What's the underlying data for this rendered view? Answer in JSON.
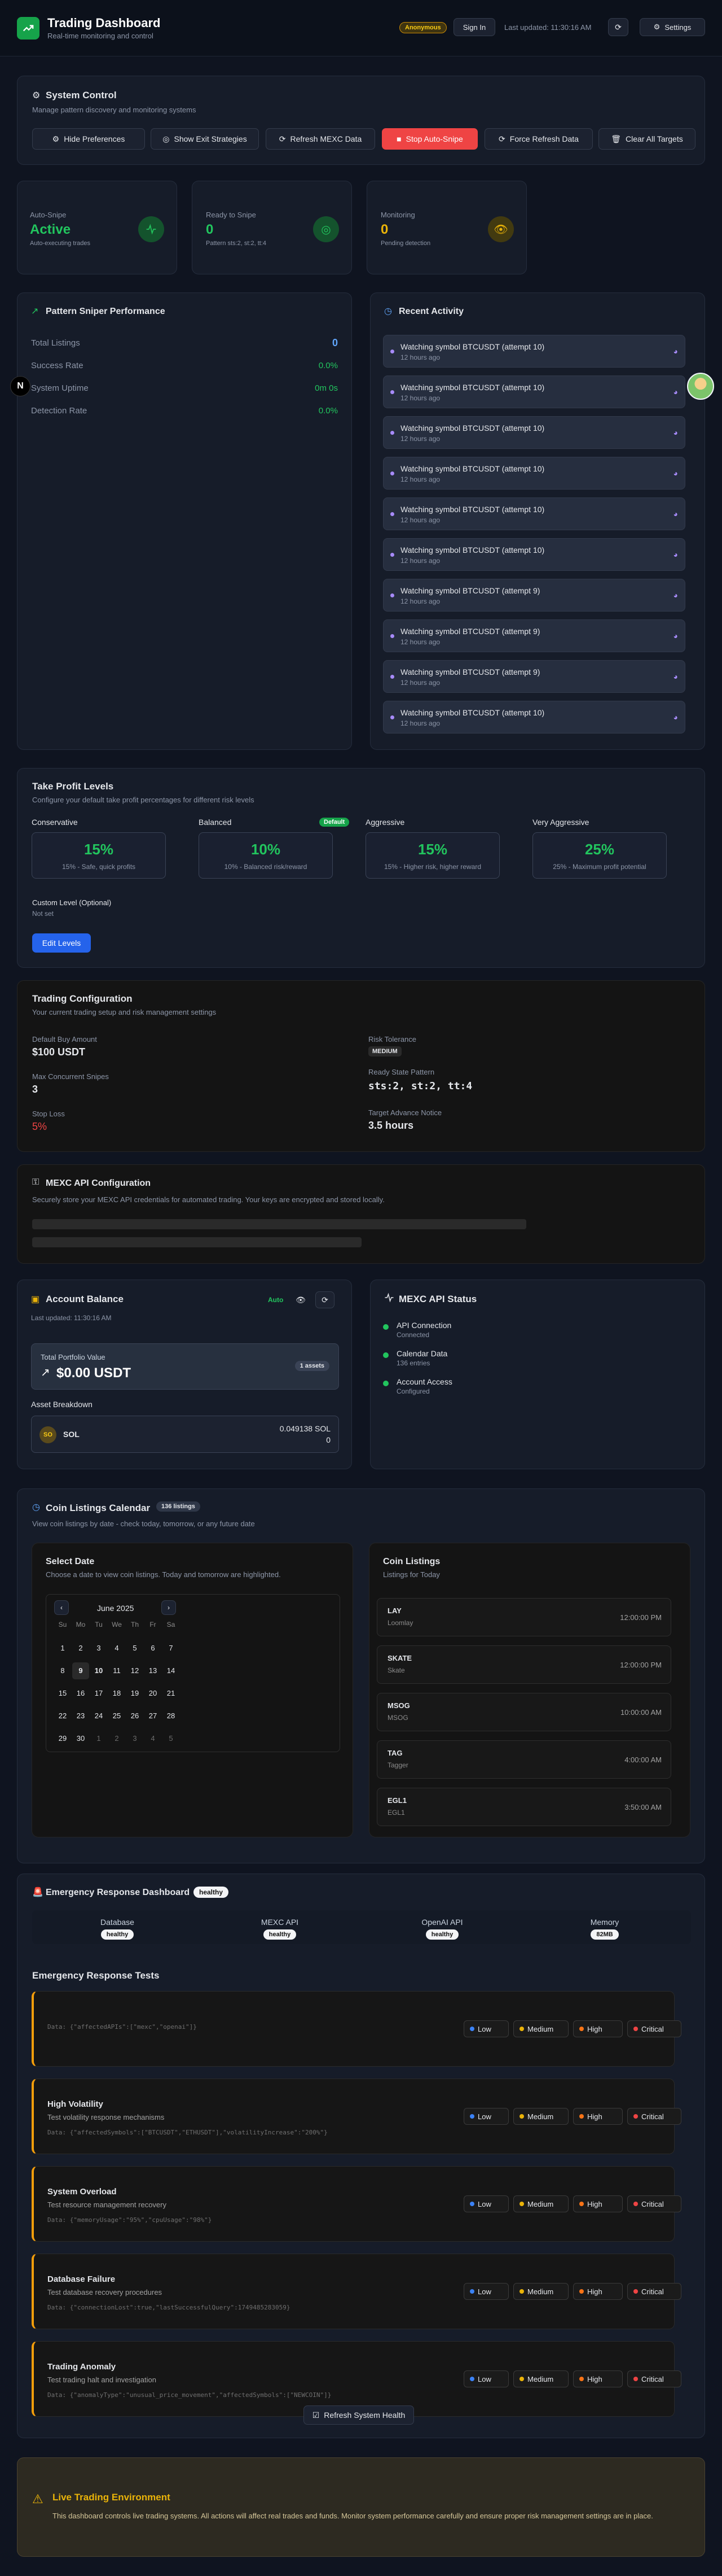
{
  "header": {
    "title": "Trading Dashboard",
    "subtitle": "Real-time monitoring and control",
    "user_badge": "Anonymous",
    "signin_label": "Sign In",
    "last_updated": "Last updated: 11:30:16 AM",
    "settings_label": "Settings"
  },
  "system_control": {
    "title": "System Control",
    "subtitle": "Manage pattern discovery and monitoring systems",
    "buttons": {
      "hide_prefs": "Hide Preferences",
      "show_exit": "Show Exit Strategies",
      "refresh_mexc": "Refresh MEXC Data",
      "stop_auto": "Stop Auto-Snipe",
      "force_refresh": "Force Refresh Data",
      "clear_targets": "Clear All Targets"
    }
  },
  "stats": {
    "auto_snipe": {
      "label": "Auto-Snipe",
      "value": "Active",
      "sub": "Auto-executing trades"
    },
    "ready": {
      "label": "Ready to Snipe",
      "value": "0",
      "sub": "Pattern sts:2, st:2, tt:4"
    },
    "monitoring": {
      "label": "Monitoring",
      "value": "0",
      "sub": "Pending detection"
    }
  },
  "performance": {
    "title": "Pattern Sniper Performance",
    "rows": [
      {
        "label": "Total Listings",
        "value": "0"
      },
      {
        "label": "Success Rate",
        "value": "0.0%"
      },
      {
        "label": "System Uptime",
        "value": "0m 0s"
      },
      {
        "label": "Detection Rate",
        "value": "0.0%"
      }
    ]
  },
  "activity": {
    "title": "Recent Activity",
    "items": [
      {
        "text": "Watching symbol BTCUSDT (attempt 10)",
        "time": "12 hours ago"
      },
      {
        "text": "Watching symbol BTCUSDT (attempt 10)",
        "time": "12 hours ago"
      },
      {
        "text": "Watching symbol BTCUSDT (attempt 10)",
        "time": "12 hours ago"
      },
      {
        "text": "Watching symbol BTCUSDT (attempt 10)",
        "time": "12 hours ago"
      },
      {
        "text": "Watching symbol BTCUSDT (attempt 10)",
        "time": "12 hours ago"
      },
      {
        "text": "Watching symbol BTCUSDT (attempt 10)",
        "time": "12 hours ago"
      },
      {
        "text": "Watching symbol BTCUSDT (attempt 9)",
        "time": "12 hours ago"
      },
      {
        "text": "Watching symbol BTCUSDT (attempt 9)",
        "time": "12 hours ago"
      },
      {
        "text": "Watching symbol BTCUSDT (attempt 9)",
        "time": "12 hours ago"
      },
      {
        "text": "Watching symbol BTCUSDT (attempt 10)",
        "time": "12 hours ago"
      }
    ]
  },
  "take_profit": {
    "title": "Take Profit Levels",
    "subtitle": "Configure your default take profit percentages for different risk levels",
    "levels": [
      {
        "name": "Conservative",
        "pct": "15%",
        "desc": "15% - Safe, quick profits"
      },
      {
        "name": "Balanced",
        "pct": "10%",
        "desc": "10% - Balanced risk/reward",
        "badge": "Default"
      },
      {
        "name": "Aggressive",
        "pct": "15%",
        "desc": "15% - Higher risk, higher reward"
      },
      {
        "name": "Very Aggressive",
        "pct": "25%",
        "desc": "25% - Maximum profit potential"
      }
    ],
    "custom_label": "Custom Level (Optional)",
    "custom_value": "Not set",
    "edit_label": "Edit Levels"
  },
  "trading_config": {
    "title": "Trading Configuration",
    "subtitle": "Your current trading setup and risk management settings",
    "default_buy_label": "Default Buy Amount",
    "default_buy_value": "$100 USDT",
    "max_snipes_label": "Max Concurrent Snipes",
    "max_snipes_value": "3",
    "stop_loss_label": "Stop Loss",
    "stop_loss_value": "5%",
    "risk_label": "Risk Tolerance",
    "risk_value": "MEDIUM",
    "ready_pattern_label": "Ready State Pattern",
    "ready_pattern_value": "sts:2, st:2, tt:4",
    "advance_label": "Target Advance Notice",
    "advance_value": "3.5 hours"
  },
  "api_config": {
    "title": "MEXC API Configuration",
    "subtitle": "Securely store your MEXC API credentials for automated trading. Your keys are encrypted and stored locally."
  },
  "balance": {
    "title": "Account Balance",
    "auto_label": "Auto",
    "last_updated": "Last updated: 11:30:16 AM",
    "portfolio_label": "Total Portfolio Value",
    "portfolio_value": "$0.00 USDT",
    "assets_badge": "1 assets",
    "breakdown_label": "Asset Breakdown",
    "asset_icon": "SO",
    "asset_name": "SOL",
    "asset_amount": "0.049138 SOL",
    "asset_value": "0"
  },
  "api_status": {
    "title": "MEXC API Status",
    "items": [
      {
        "label": "API Connection",
        "sub": "Connected"
      },
      {
        "label": "Calendar Data",
        "sub": "136 entries"
      },
      {
        "label": "Account Access",
        "sub": "Configured"
      }
    ]
  },
  "calendar": {
    "title": "Coin Listings Calendar",
    "badge": "136 listings",
    "subtitle": "View coin listings by date - check today, tomorrow, or any future date",
    "select_title": "Select Date",
    "select_sub": "Choose a date to view coin listings. Today and tomorrow are highlighted.",
    "month": "June 2025",
    "weekdays": [
      "Su",
      "Mo",
      "Tu",
      "We",
      "Th",
      "Fr",
      "Sa"
    ],
    "weeks": [
      [
        "1",
        "2",
        "3",
        "4",
        "5",
        "6",
        "7"
      ],
      [
        "8",
        "9",
        "10",
        "11",
        "12",
        "13",
        "14"
      ],
      [
        "15",
        "16",
        "17",
        "18",
        "19",
        "20",
        "21"
      ],
      [
        "22",
        "23",
        "24",
        "25",
        "26",
        "27",
        "28"
      ],
      [
        "29",
        "30",
        "1",
        "2",
        "3",
        "4",
        "5"
      ]
    ],
    "listings_title": "Coin Listings",
    "listings_sub": "Listings for Today",
    "listings": [
      {
        "symbol": "LAY",
        "name": "Loomlay",
        "time": "12:00:00 PM"
      },
      {
        "symbol": "SKATE",
        "name": "Skate",
        "time": "12:00:00 PM"
      },
      {
        "symbol": "MSOG",
        "name": "MSOG",
        "time": "10:00:00 AM"
      },
      {
        "symbol": "TAG",
        "name": "Tagger",
        "time": "4:00:00 AM"
      },
      {
        "symbol": "EGL1",
        "name": "EGL1",
        "time": "3:50:00 AM"
      }
    ]
  },
  "emergency": {
    "title": "Emergency Response Dashboard",
    "status_badge": "healthy",
    "health": [
      {
        "label": "Database",
        "value": "healthy"
      },
      {
        "label": "MEXC API",
        "value": "healthy"
      },
      {
        "label": "OpenAI API",
        "value": "healthy"
      },
      {
        "label": "Memory",
        "value": "82MB"
      }
    ],
    "tests_title": "Emergency Response Tests",
    "severity": [
      "Low",
      "Medium",
      "High",
      "Critical"
    ],
    "tests": [
      {
        "title": "",
        "desc": "",
        "data": "Data: {\"affectedAPIs\":[\"mexc\",\"openai\"]}"
      },
      {
        "title": "High Volatility",
        "desc": "Test volatility response mechanisms",
        "data": "Data: {\"affectedSymbols\":[\"BTCUSDT\",\"ETHUSDT\"],\"volatilityIncrease\":\"200%\"}"
      },
      {
        "title": "System Overload",
        "desc": "Test resource management recovery",
        "data": "Data: {\"memoryUsage\":\"95%\",\"cpuUsage\":\"98%\"}"
      },
      {
        "title": "Database Failure",
        "desc": "Test database recovery procedures",
        "data": "Data: {\"connectionLost\":true,\"lastSuccessfulQuery\":1749485283059}"
      },
      {
        "title": "Trading Anomaly",
        "desc": "Test trading halt and investigation",
        "data": "Data: {\"anomalyType\":\"unusual_price_movement\",\"affectedSymbols\":[\"NEWCOIN\"]}"
      }
    ],
    "refresh_label": "Refresh System Health"
  },
  "warning": {
    "title": "Live Trading Environment",
    "text": "This dashboard controls live trading systems. All actions will affect real trades and funds. Monitor system performance carefully and ensure proper risk management settings are in place."
  },
  "colors": {
    "accent_green": "#22c55e",
    "danger_red": "#ef4444",
    "warning_amber": "#f59e0b",
    "primary_blue": "#2563eb"
  }
}
